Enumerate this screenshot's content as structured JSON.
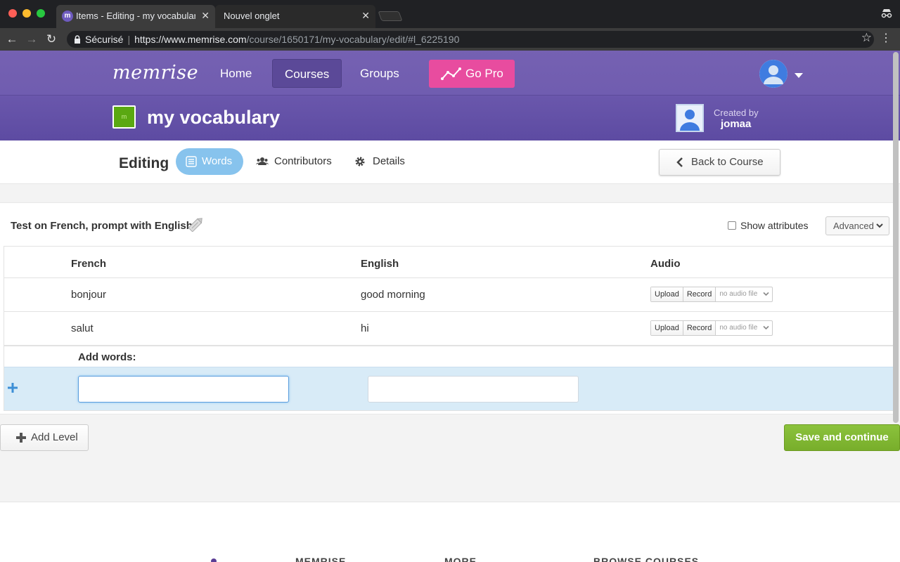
{
  "browser": {
    "tabs": [
      {
        "title": "Items - Editing - my vocabulary",
        "active": true
      },
      {
        "title": "Nouvel onglet",
        "active": false
      }
    ],
    "address": {
      "secure_label": "Sécurisé",
      "url_host": "https://www.memrise.com",
      "url_path": "/course/1650171/my-vocabulary/edit/#l_6225190"
    }
  },
  "header": {
    "logo": "memrise",
    "nav": {
      "home": "Home",
      "courses": "Courses",
      "groups": "Groups",
      "gopro": "Go Pro"
    }
  },
  "course": {
    "icon_text": "m",
    "title": "my vocabulary",
    "created_by_label": "Created by",
    "creator": "jomaa"
  },
  "editbar": {
    "editing_label": "Editing",
    "tabs": {
      "words": "Words",
      "contributors": "Contributors",
      "details": "Details"
    },
    "back": "Back to Course"
  },
  "level": {
    "test_label": "Test on French, prompt with English.",
    "show_attributes": "Show attributes",
    "show_attributes_checked": false,
    "advanced": "Advanced",
    "columns": [
      "French",
      "English",
      "Audio"
    ],
    "rows": [
      {
        "french": "bonjour",
        "english": "good morning",
        "upload": "Upload",
        "record": "Record",
        "audio": "no audio file"
      },
      {
        "french": "salut",
        "english": "hi",
        "upload": "Upload",
        "record": "Record",
        "audio": "no audio file"
      }
    ],
    "add_words_label": "Add words:",
    "new_french": "",
    "new_english": ""
  },
  "actions": {
    "add_level": "Add Level",
    "save": "Save and continue"
  },
  "footer": {
    "headings": [
      "MEMRISE",
      "MORE",
      "BROWSE COURSES"
    ]
  },
  "colors": {
    "brand_purple": "#6b58ad",
    "go_pro_pink": "#e84c9f",
    "words_pill": "#87c3ed",
    "save_green": "#80b833",
    "new_row_blue": "#d8ebf7"
  }
}
